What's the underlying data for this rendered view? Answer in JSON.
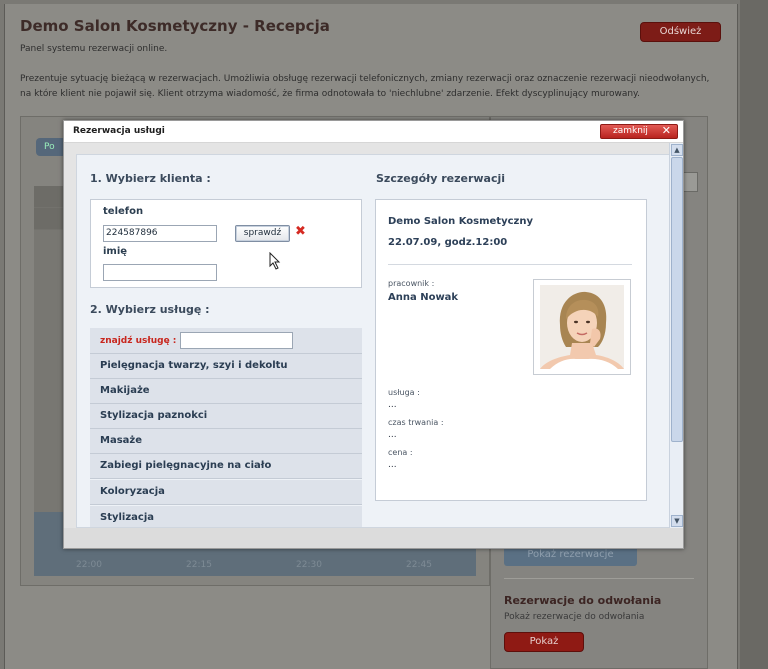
{
  "background": {
    "title": "Demo Salon Kosmetyczny - Recepcja",
    "subtitle": "Panel systemu rezerwacji online.",
    "description": "Prezentuje sytuację bieżącą w rezerwacjach. Umożliwia obsługę rezerwacji telefonicznych, zmiany rezerwacji oraz oznaczenie rezerwacji nieodwołanych, na które klient nie pojawił się. Klient otrzyma wiadomość, że firma odnotowała to 'niechlubne' zdarzenie. Efekt dyscyplinujący murowany.",
    "refresh_label": "Odśwież",
    "pill_label": "Po",
    "times": [
      "22:00",
      "22:15",
      "22:30",
      "22:45"
    ],
    "blue_button_label": "Pokaż rezerwacje",
    "cancel_section": {
      "title": "Rezerwacje do odwołania",
      "subtitle": "Pokaż rezerwacje do odwołania",
      "button_label": "Pokaż"
    }
  },
  "modal": {
    "title": "Rezerwacja usługi",
    "close_label": "zamknij",
    "close_icon": "x-icon",
    "client": {
      "heading": "1. Wybierz klienta :",
      "phone_label": "telefon",
      "phone_value": "224587896",
      "check_label": "sprawdź",
      "name_label": "imię",
      "name_value": ""
    },
    "service": {
      "heading": "2. Wybierz usługę :",
      "search_label": "znajdź usługę :",
      "search_value": "",
      "items": [
        "Pielęgnacja twarzy, szyi i dekoltu",
        "Makijaże",
        "Stylizacja paznokci",
        "Masaże",
        "Zabiegi pielęgnacyjne na ciało",
        "Koloryzacja",
        "Stylizacja"
      ]
    },
    "details": {
      "heading": "Szczegóły rezerwacji",
      "salon_name": "Demo Salon Kosmetyczny",
      "date_time": "22.07.09, godz.12:00",
      "employee_label": "pracownik :",
      "employee_name": "Anna Nowak",
      "service_label": "usługa :",
      "service_value": "...",
      "duration_label": "czas trwania :",
      "duration_value": "...",
      "price_label": "cena :",
      "price_value": "..."
    }
  },
  "colors": {
    "accent_red": "#c8261d",
    "heading_blue": "#3b4a5c"
  }
}
